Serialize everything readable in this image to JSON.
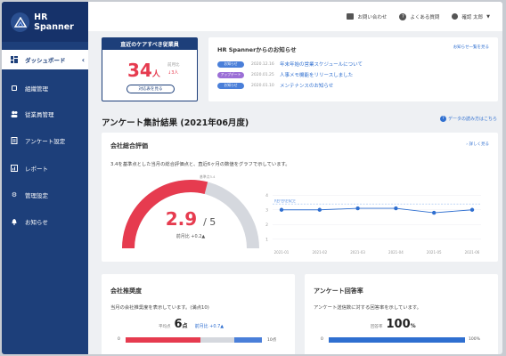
{
  "app": {
    "name": "HR Spanner"
  },
  "topbar": {
    "contact": "お問い合わせ",
    "faq": "よくある質問",
    "user": "確認 太郎"
  },
  "sidebar": {
    "items": [
      {
        "label": "ダッシュボード",
        "icon": "dashboard-icon"
      },
      {
        "label": "組織管理",
        "icon": "building-icon"
      },
      {
        "label": "従業員管理",
        "icon": "users-icon"
      },
      {
        "label": "アンケート設定",
        "icon": "clipboard-icon"
      },
      {
        "label": "レポート",
        "icon": "report-icon"
      },
      {
        "label": "管理設定",
        "icon": "gear-icon"
      },
      {
        "label": "お知らせ",
        "icon": "bell-icon"
      }
    ]
  },
  "care": {
    "title": "直近のケアすべき従業員",
    "count": "34",
    "unit": "人",
    "prev_label": "前月比",
    "diff": "↓3人",
    "button": "対応表を見る"
  },
  "news": {
    "title": "HR Spannerからのお知らせ",
    "all_link": "お知らせ一覧を見る",
    "items": [
      {
        "badge": "お知らせ",
        "color": "#4a7fd9",
        "date": "2020.12.16",
        "text": "年末年始の営業スケジュールについて"
      },
      {
        "badge": "アップデート",
        "color": "#9b6fd6",
        "date": "2020.01.25",
        "text": "人事メモ機能をリリースしました"
      },
      {
        "badge": "お知らせ",
        "color": "#4a7fd9",
        "date": "2020.01.10",
        "text": "メンテナンスのお知らせ"
      }
    ]
  },
  "survey": {
    "title": "アンケート集計結果 (2021年06月度)",
    "howto": "データの読み方はこちら"
  },
  "evaluation": {
    "title": "会社総合評価",
    "more": "詳しく見る",
    "desc": "3.4を基準点とした当月の総合評価点と、直近6ヶ月の数値をグラフで示しています。",
    "value": "2.9",
    "max": "/ 5",
    "fill_ratio": 0.58,
    "standard": "基準点3.4",
    "compare": "前月比 +0.2▲",
    "colors": {
      "fill": "#e63b4f",
      "track": "#d5d8de"
    }
  },
  "chart_data": {
    "type": "line",
    "x": [
      "2021-01",
      "2021-02",
      "2021-03",
      "2021-04",
      "2021-05",
      "2021-06"
    ],
    "values": [
      3.0,
      3.0,
      3.1,
      3.1,
      2.8,
      3.0
    ],
    "y_ticks": [
      "4",
      "3",
      "2",
      "1"
    ],
    "ylim": [
      0.5,
      4.5
    ],
    "reference": {
      "label": "REFERENCE",
      "value": 3.4
    },
    "color": "#2f6fd0"
  },
  "nps": {
    "title": "会社推奨度",
    "desc": "当月の会社推奨度を表示しています。(満点10)",
    "avg_label": "平均点",
    "value": "6",
    "unit": "点",
    "delta_label": "前月比 +0.7▲",
    "min": "0",
    "max": "10点",
    "segments": [
      {
        "color": "#e63b4f",
        "value": 0.55
      },
      {
        "color": "#d5d8de",
        "value": 0.25
      },
      {
        "color": "#4a7fd9",
        "value": 0.2
      }
    ]
  },
  "response": {
    "title": "アンケート回答率",
    "desc": "アンケート送信数に対する回答率を示しています。",
    "label": "回答率",
    "value": "100",
    "unit": "%",
    "rate": 1.0,
    "min": "0",
    "max": "100%",
    "color": "#2f6fd0"
  }
}
